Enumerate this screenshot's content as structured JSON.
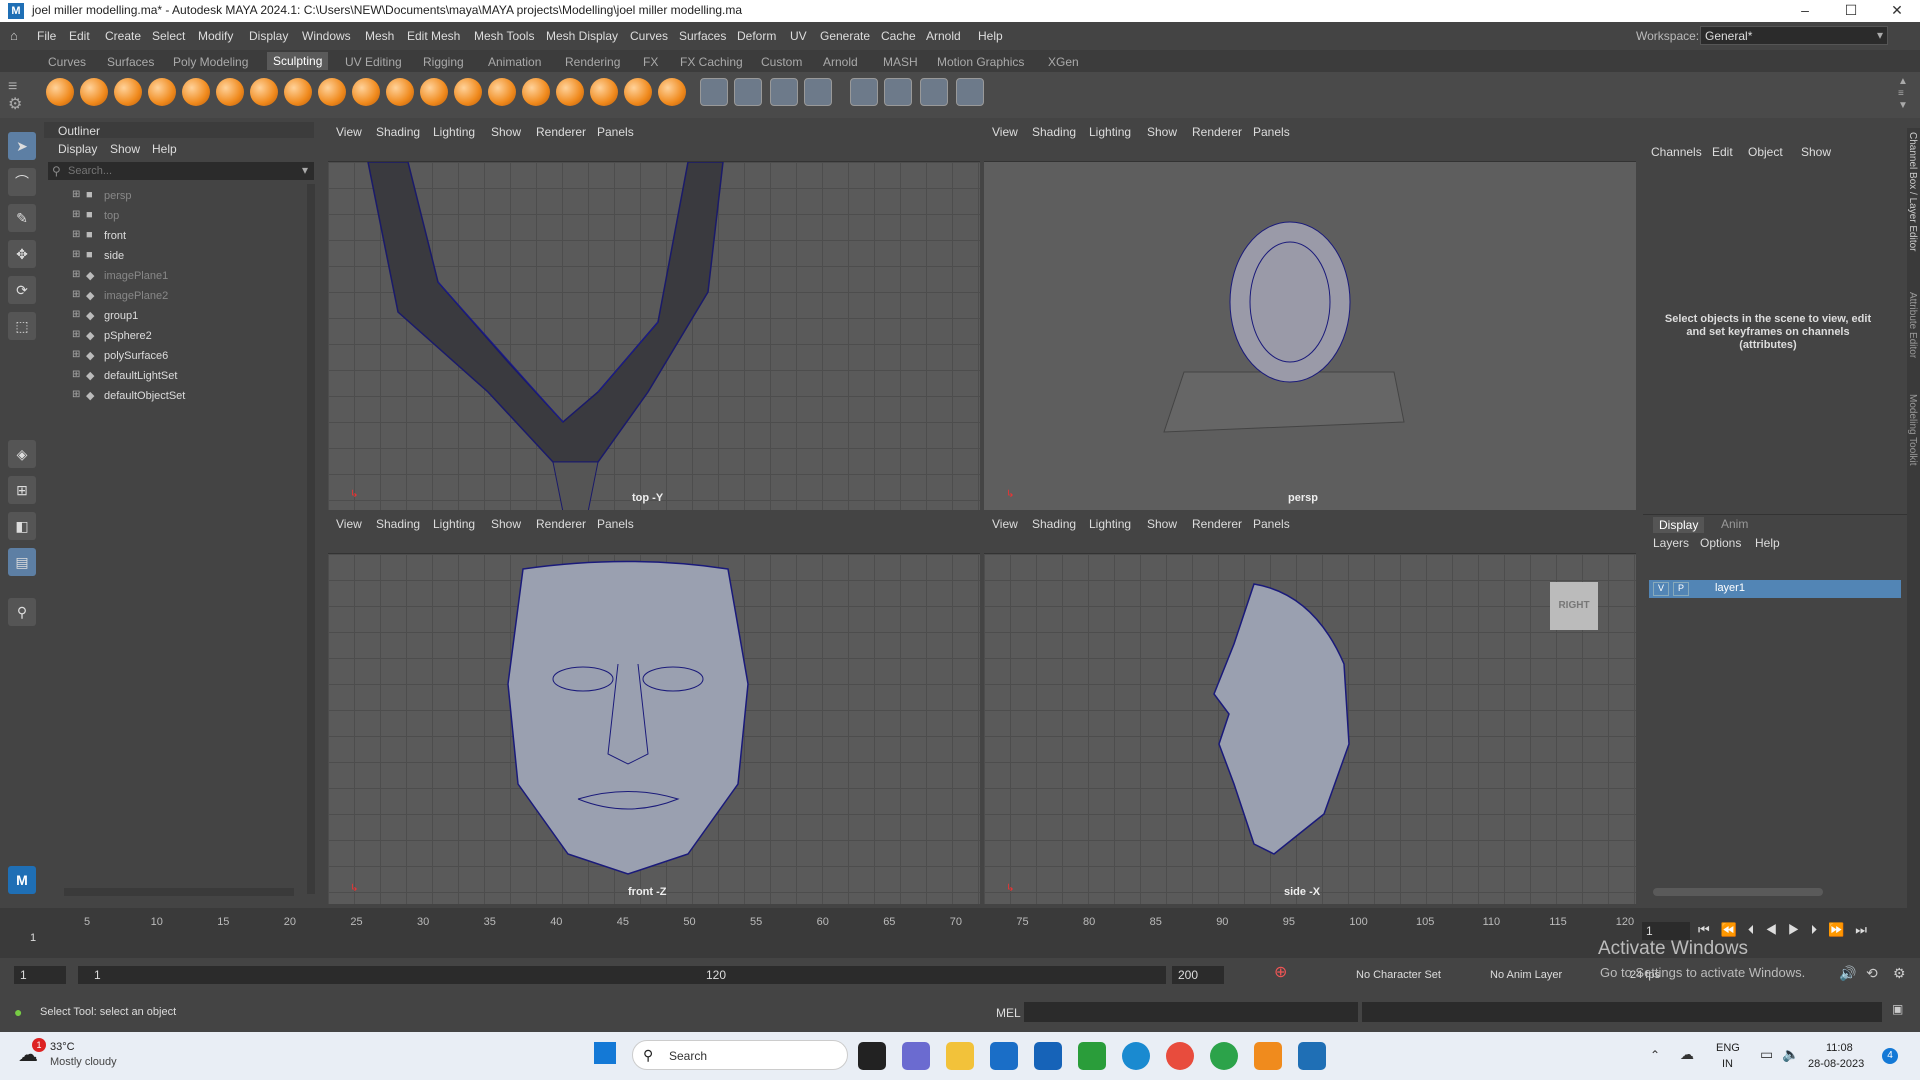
{
  "window": {
    "title": "joel miller modelling.ma* - Autodesk MAYA 2024.1: C:\\Users\\NEW\\Documents\\maya\\MAYA  projects\\Modelling\\joel miller modelling.ma",
    "logo": "M",
    "minimize": "–",
    "maximize": "☐",
    "close": "✕"
  },
  "menu": [
    "File",
    "Edit",
    "Create",
    "Select",
    "Modify",
    "Display",
    "Windows",
    "Mesh",
    "Edit Mesh",
    "Mesh Tools",
    "Mesh Display",
    "Curves",
    "Surfaces",
    "Deform",
    "UV",
    "Generate",
    "Cache",
    "Arnold",
    "Help"
  ],
  "workspace": {
    "label": "Workspace:",
    "value": "General*"
  },
  "shelf_tabs": [
    "Curves",
    "Surfaces",
    "Poly Modeling",
    "Sculpting",
    "UV Editing",
    "Rigging",
    "Animation",
    "Rendering",
    "FX",
    "FX Caching",
    "Custom",
    "Arnold",
    "MASH",
    "Motion Graphics",
    "XGen"
  ],
  "active_shelf": "Sculpting",
  "outliner": {
    "title": "Outliner",
    "menus": [
      "Display",
      "Show",
      "Help"
    ],
    "search_placeholder": "Search...",
    "items": [
      {
        "label": "persp",
        "dim": true
      },
      {
        "label": "top",
        "dim": true
      },
      {
        "label": "front",
        "dim": false
      },
      {
        "label": "side",
        "dim": false
      },
      {
        "label": "imagePlane1",
        "dim": true
      },
      {
        "label": "imagePlane2",
        "dim": true
      },
      {
        "label": "group1",
        "dim": false
      },
      {
        "label": "pSphere2",
        "dim": false
      },
      {
        "label": "polySurface6",
        "dim": false
      },
      {
        "label": "defaultLightSet",
        "dim": false
      },
      {
        "label": "defaultObjectSet",
        "dim": false
      }
    ]
  },
  "panel_menus": [
    "View",
    "Shading",
    "Lighting",
    "Show",
    "Renderer",
    "Panels"
  ],
  "viewports": {
    "top": "top -Y",
    "persp": "persp",
    "front": "front -Z",
    "side": "side -X",
    "viewcube": "RIGHT"
  },
  "channelbox": {
    "menus": [
      "Channels",
      "Edit",
      "Object",
      "Show"
    ],
    "message": "Select objects in the scene to view, edit and set keyframes on channels (attributes)",
    "side_tabs": [
      "Channel Box / Layer Editor",
      "Attribute Editor",
      "Modeling Toolkit"
    ]
  },
  "layers": {
    "tabs": [
      "Display",
      "Anim"
    ],
    "menus": [
      "Layers",
      "Options",
      "Help"
    ],
    "layer_name": "layer1",
    "v": "V",
    "p": "P"
  },
  "timeline": {
    "ticks": [
      "5",
      "10",
      "15",
      "20",
      "25",
      "30",
      "35",
      "40",
      "45",
      "50",
      "55",
      "60",
      "65",
      "70",
      "75",
      "80",
      "85",
      "90",
      "95",
      "100",
      "105",
      "110",
      "115",
      "120"
    ],
    "first": "1",
    "current_frame": "1"
  },
  "range": {
    "start": "1",
    "inner_start": "1",
    "inner_end": "120",
    "end": "200",
    "character_set": "No Character Set",
    "anim_layer": "No Anim Layer",
    "fps": "24 fps"
  },
  "status": {
    "help_text": "Select Tool: select an object",
    "mel_label": "MEL"
  },
  "watermark": {
    "line1": "Activate Windows",
    "line2": "Go to Settings to activate Windows."
  },
  "taskbar": {
    "weather_temp": "33°C",
    "weather_desc": "Mostly cloudy",
    "search_label": "Search",
    "lang1": "ENG",
    "lang2": "IN",
    "time": "11:08",
    "date": "28-08-2023",
    "notif_count": "4",
    "weather_badge": "1"
  }
}
